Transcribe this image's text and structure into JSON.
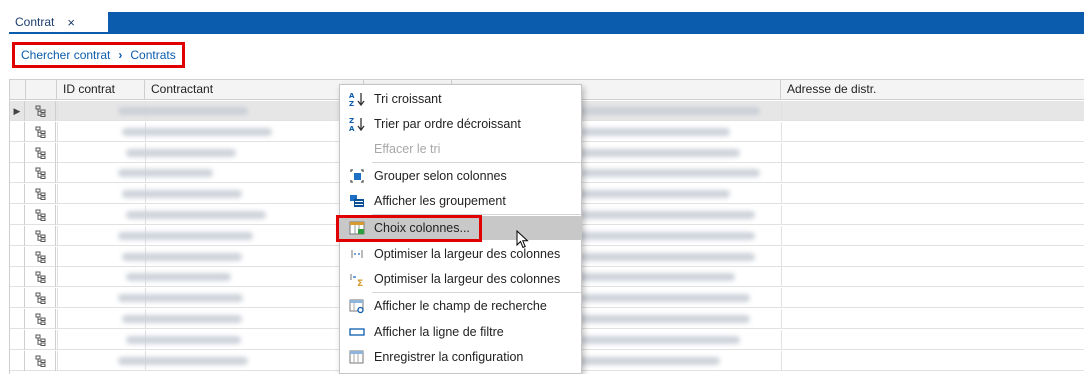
{
  "tab": {
    "title": "Contrat",
    "close_symbol": "×"
  },
  "breadcrumb": {
    "items": [
      "Chercher contrat",
      "Contrats"
    ],
    "separator": "›"
  },
  "grid": {
    "columns": [
      "ID contrat",
      "Contractant",
      "Adresse de distr."
    ],
    "row_count": 13,
    "selected_row": 0
  },
  "context_menu": {
    "items": [
      {
        "label": "Tri croissant",
        "icon": "sort-ascending-icon",
        "state": "normal"
      },
      {
        "label": "Trier par ordre décroissant",
        "icon": "sort-descending-icon",
        "state": "normal"
      },
      {
        "label": "Effacer le tri",
        "icon": "",
        "state": "disabled"
      },
      {
        "label": "Grouper selon colonnes",
        "icon": "group-columns-icon",
        "state": "normal"
      },
      {
        "label": "Afficher les groupement",
        "icon": "show-grouping-icon",
        "state": "normal"
      },
      {
        "label": "Choix colonnes...",
        "icon": "column-chooser-icon",
        "state": "highlighted"
      },
      {
        "label": "Optimiser la largeur des colonnes",
        "icon": "best-fit-icon",
        "state": "normal"
      },
      {
        "label": "Optimiser la largeur des colonnes",
        "icon": "best-fit-all-icon",
        "state": "normal"
      },
      {
        "label": "Afficher le champ de recherche",
        "icon": "search-panel-icon",
        "state": "normal"
      },
      {
        "label": "Afficher la ligne de filtre",
        "icon": "filter-row-icon",
        "state": "normal"
      },
      {
        "label": "Enregistrer la configuration",
        "icon": "save-layout-icon",
        "state": "normal"
      }
    ]
  },
  "colors": {
    "accent": "#0b5cad",
    "annotation": "#e00000",
    "highlight": "#c8c8c8"
  }
}
